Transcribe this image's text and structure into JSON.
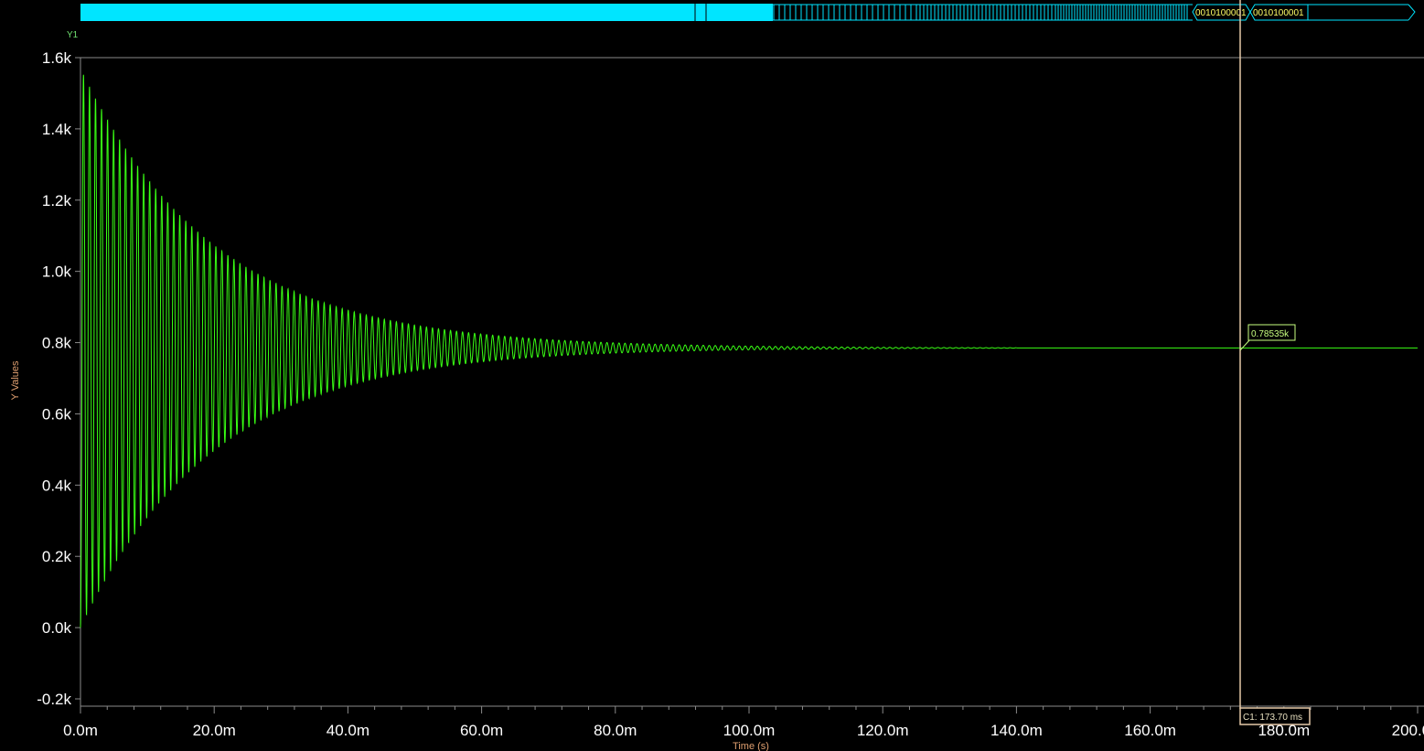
{
  "colors": {
    "background": "#000000",
    "trace": "#39ff14",
    "bus": "#00e5ff",
    "cursor": "#e6c9a8",
    "axis_title": "#e0a070",
    "tick_text": "#ffffff"
  },
  "digital_bus": {
    "values": [
      "0010100001",
      "0010100001"
    ]
  },
  "cursor": {
    "label": "C1: 173.70 ms",
    "time_ms": 173.7,
    "readout": "0.78535k",
    "readout_value": 785.35
  },
  "chart_data": {
    "type": "line",
    "trace_name": "Y1",
    "xlabel": "Time (s)",
    "ylabel": "Y Values",
    "xlim": [
      0,
      0.2
    ],
    "ylim": [
      -0.2,
      1.6
    ],
    "x_ticks": [
      "0.0m",
      "20.0m",
      "40.0m",
      "60.0m",
      "80.0m",
      "100.0m",
      "120.0m",
      "140.0m",
      "160.0m",
      "180.0m",
      "200.0m"
    ],
    "y_ticks": [
      "1.6k",
      "1.4k",
      "1.2k",
      "1.0k",
      "0.8k",
      "0.6k",
      "0.4k",
      "0.2k",
      "0.0k",
      "-0.2k"
    ],
    "series": [
      {
        "steady_value_k": 0.785,
        "initial_amplitude_k": 0.785,
        "decay_time_constant_s": 0.02,
        "oscillation_period_s": 0.0009,
        "envelope": {
          "t_s": [
            0.0,
            0.01,
            0.02,
            0.03,
            0.04,
            0.05,
            0.06,
            0.08,
            0.1,
            0.14,
            0.2
          ],
          "max_k": [
            1.56,
            1.4,
            1.16,
            1.0,
            0.88,
            0.84,
            0.82,
            0.795,
            0.79,
            0.786,
            0.785
          ],
          "min_k": [
            0.0,
            0.19,
            0.4,
            0.57,
            0.67,
            0.73,
            0.75,
            0.775,
            0.78,
            0.784,
            0.785
          ]
        }
      }
    ]
  }
}
